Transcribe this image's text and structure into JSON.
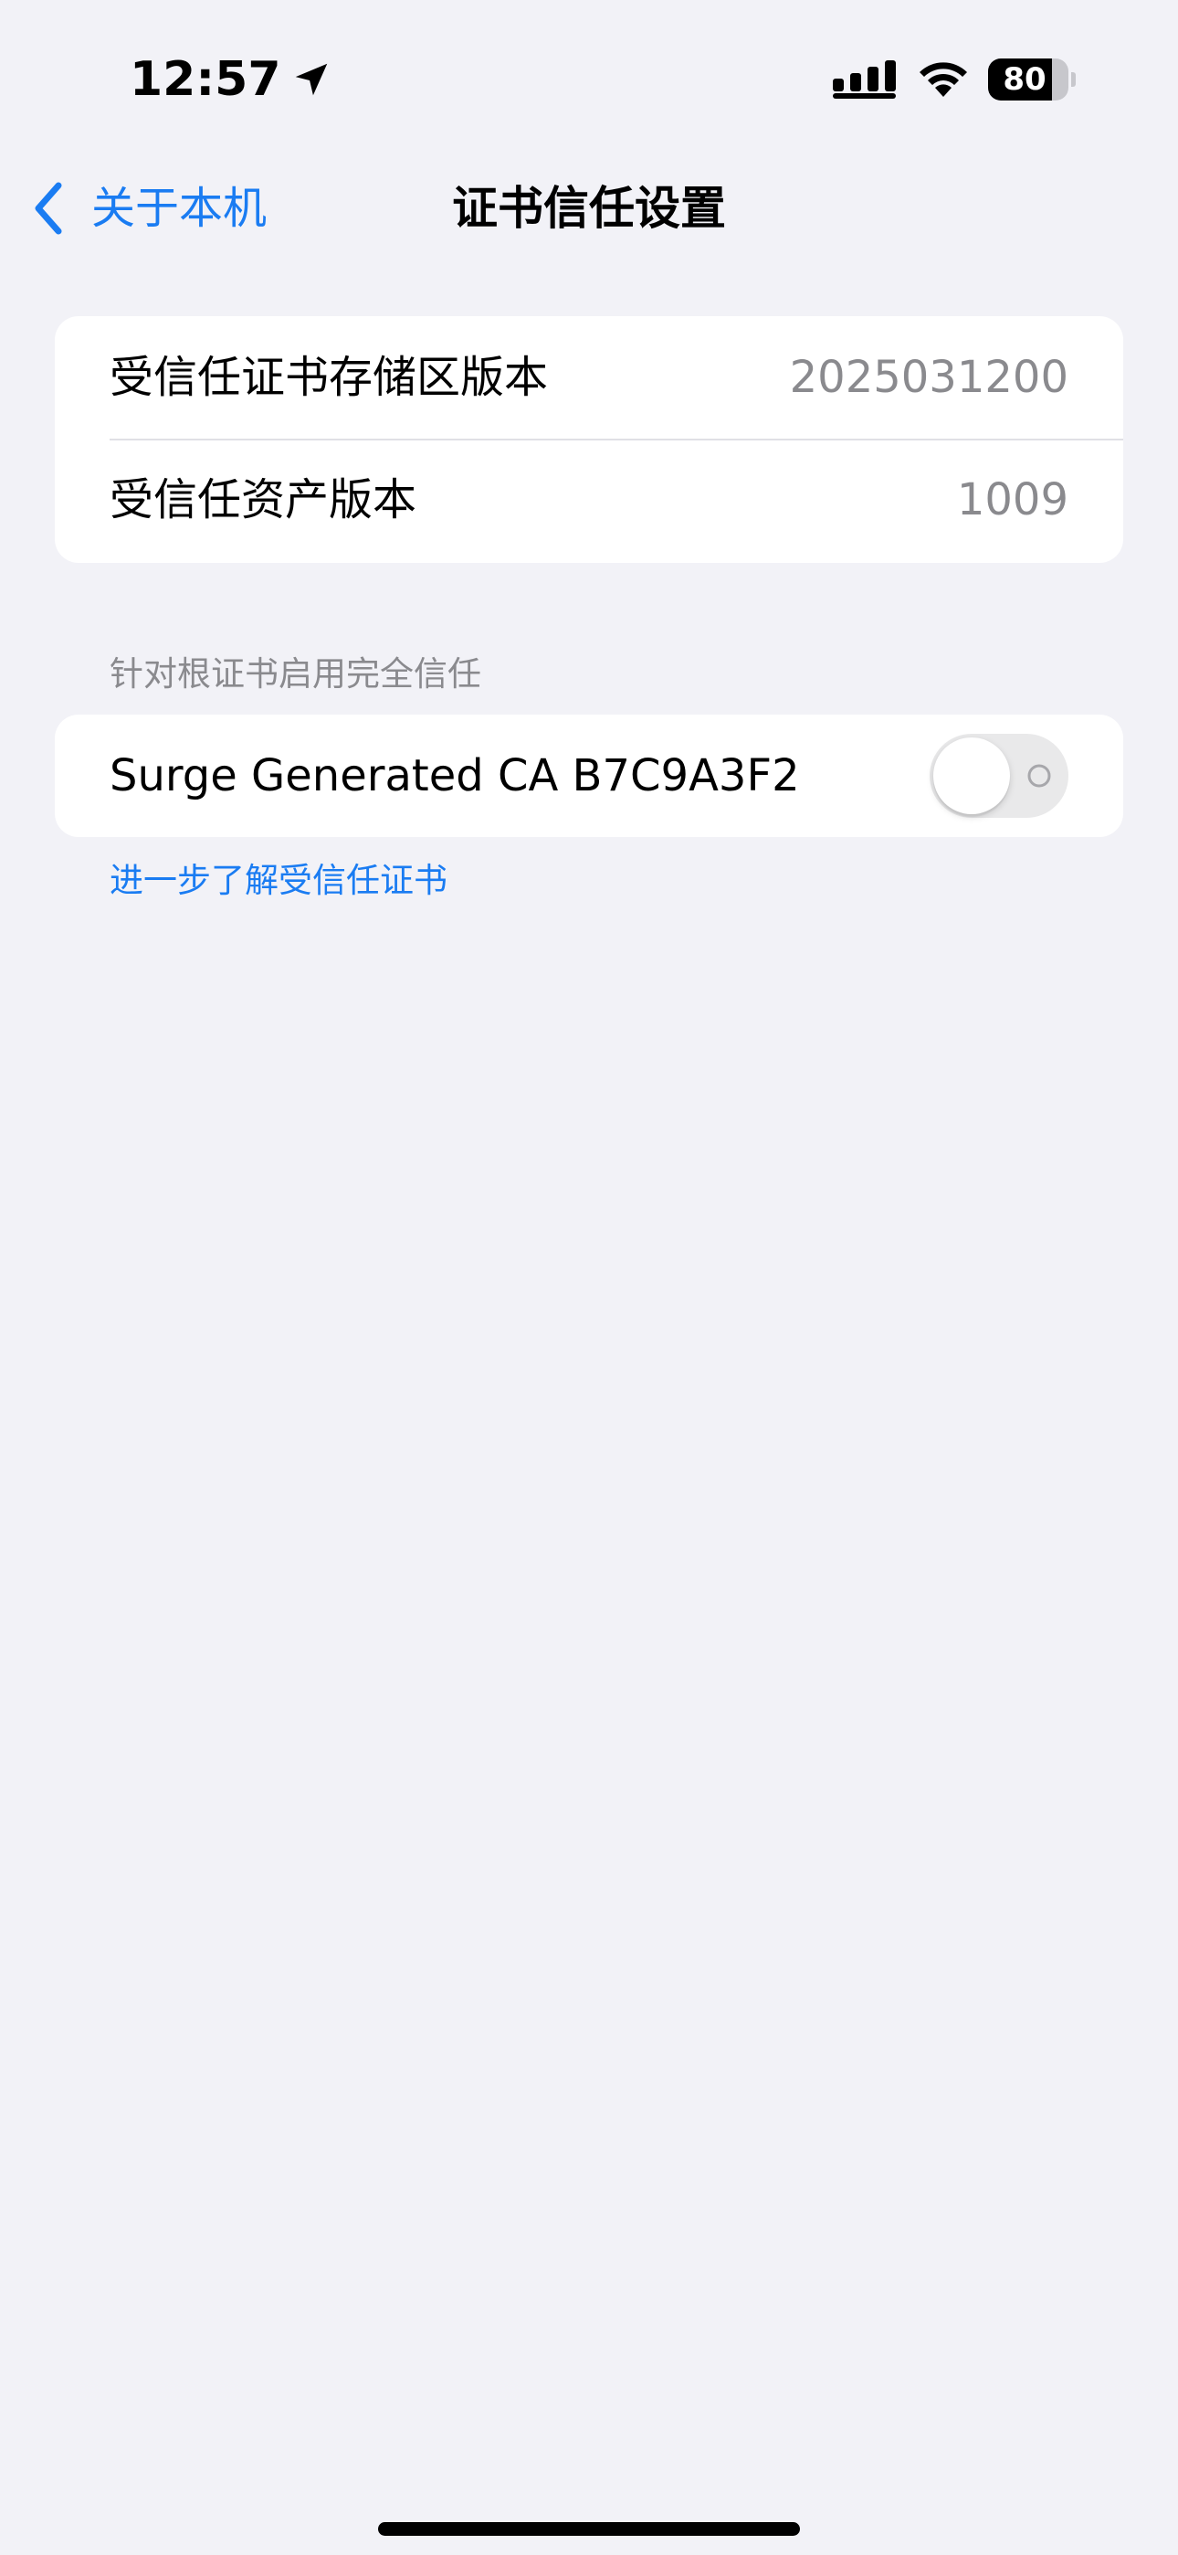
{
  "status_bar": {
    "time": "12:57",
    "battery_level": "80",
    "battery_fraction": 0.8,
    "icons": [
      "location-arrow-icon",
      "cellular-signal-icon",
      "wifi-icon",
      "battery-icon"
    ]
  },
  "nav": {
    "back_label": "关于本机",
    "title": "证书信任设置",
    "icons": [
      "chevron-left-icon"
    ]
  },
  "versions": {
    "rows": [
      {
        "label": "受信任证书存储区版本",
        "value": "2025031200"
      },
      {
        "label": "受信任资产版本",
        "value": "1009"
      }
    ]
  },
  "trust_section": {
    "header": "针对根证书启用完全信任",
    "certificate_name": "Surge Generated CA B7C9A3F2",
    "enabled": false
  },
  "footer": {
    "link_label": "进一步了解受信任证书"
  },
  "colors": {
    "background": "#F2F2F7",
    "card": "#FFFFFF",
    "accent": "#1A7CF2",
    "secondary_text": "#8A8A8E",
    "toggle_off": "#E9E9EA"
  }
}
